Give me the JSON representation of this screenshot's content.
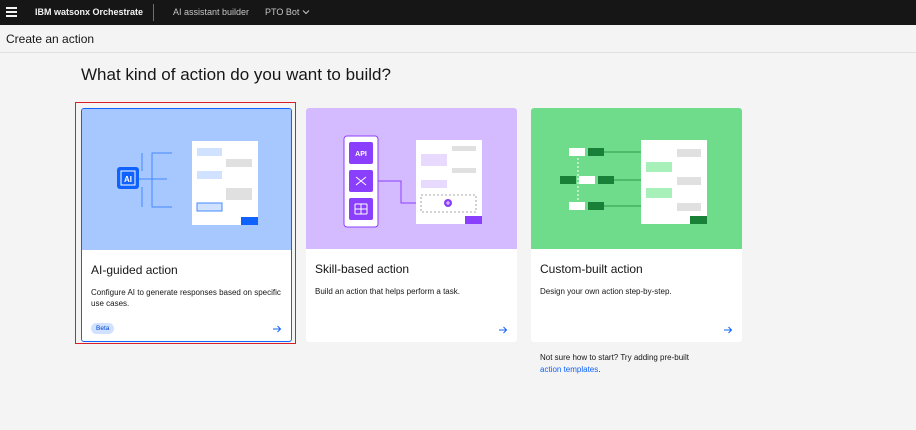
{
  "header": {
    "brand": "IBM watsonx Orchestrate",
    "nav_builder": "AI assistant builder",
    "nav_bot": "PTO Bot"
  },
  "page": {
    "title": "Create an action",
    "heading": "What kind of action do you want to build?"
  },
  "cards": [
    {
      "title": "AI-guided action",
      "description": "Configure AI to generate responses based on specific use cases.",
      "badge": "Beta",
      "art_color": "#a6c8ff"
    },
    {
      "title": "Skill-based action",
      "description": "Build an action that helps perform a task.",
      "art_color": "#d4bbff",
      "art_labels": {
        "api": "API"
      }
    },
    {
      "title": "Custom-built action",
      "description": "Design your own action step-by-step.",
      "art_color": "#6fdc8c"
    }
  ],
  "ai_icon_label": "AI",
  "tip": {
    "text": "Not sure how to start? Try adding pre-built",
    "link": "action templates",
    "suffix": "."
  },
  "colors": {
    "accent": "#0f62fe",
    "purple": "#8a3ffc",
    "green": "#198038",
    "highlight": "#da1e28"
  }
}
